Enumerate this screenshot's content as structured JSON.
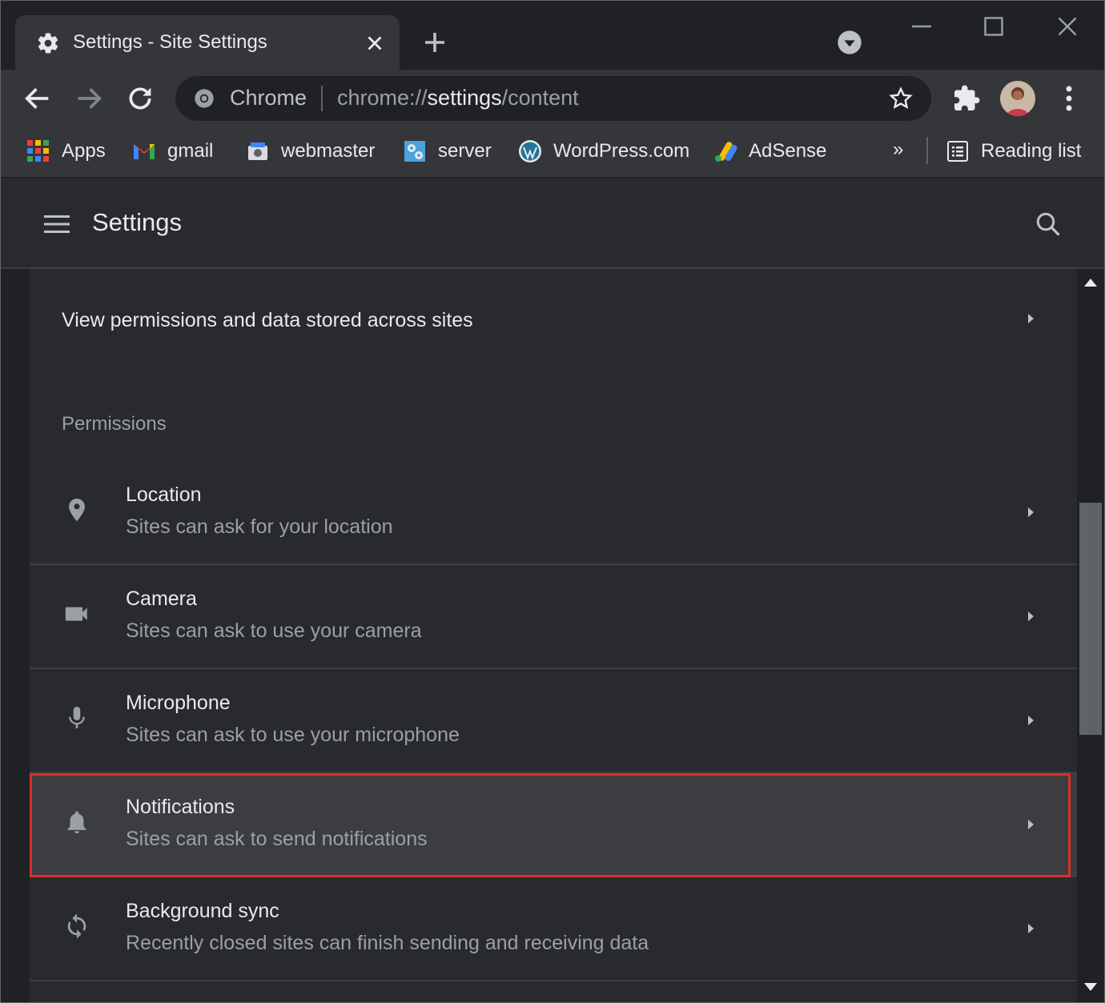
{
  "window": {
    "tab_title": "Settings - Site Settings"
  },
  "toolbar": {
    "omnibox_chip": "Chrome",
    "url_scheme": "chrome://",
    "url_host": "settings",
    "url_path": "/content"
  },
  "bookmarks": [
    {
      "label": "Apps",
      "icon": "apps-grid-icon"
    },
    {
      "label": "gmail",
      "icon": "gmail-icon"
    },
    {
      "label": "webmaster",
      "icon": "webmaster-icon"
    },
    {
      "label": "server",
      "icon": "server-icon"
    },
    {
      "label": "WordPress.com",
      "icon": "wordpress-icon"
    },
    {
      "label": "AdSense",
      "icon": "adsense-icon"
    }
  ],
  "bookmarks_more": "»",
  "reading_list": "Reading list",
  "settings": {
    "title": "Settings",
    "view_permissions": "View permissions and data stored across sites",
    "permissions_heading": "Permissions",
    "permissions": [
      {
        "title": "Location",
        "desc": "Sites can ask for your location",
        "icon": "location-pin-icon"
      },
      {
        "title": "Camera",
        "desc": "Sites can ask to use your camera",
        "icon": "camera-icon"
      },
      {
        "title": "Microphone",
        "desc": "Sites can ask to use your microphone",
        "icon": "microphone-icon"
      },
      {
        "title": "Notifications",
        "desc": "Sites can ask to send notifications",
        "icon": "bell-icon"
      },
      {
        "title": "Background sync",
        "desc": "Recently closed sites can finish sending and receiving data",
        "icon": "sync-icon"
      }
    ]
  },
  "colors": {
    "highlight_border": "#d93025",
    "background": "#202124",
    "card": "#292a2d"
  }
}
